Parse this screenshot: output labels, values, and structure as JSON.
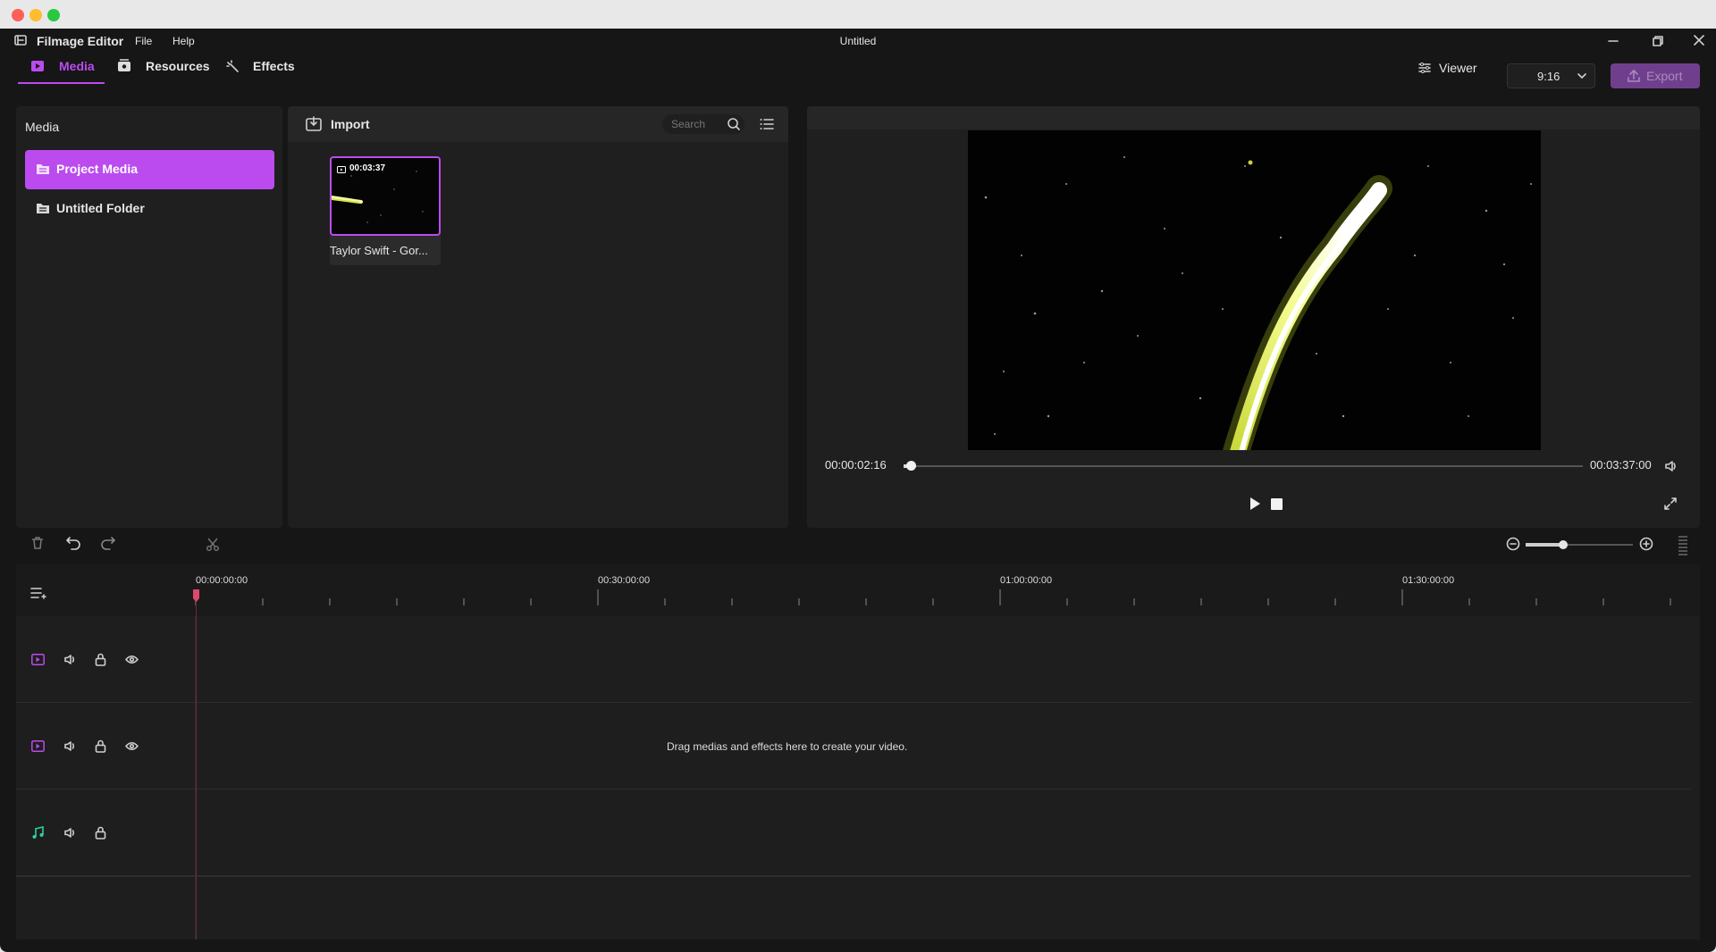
{
  "app": {
    "name": "Filmage Editor",
    "menu": [
      "File",
      "Help"
    ],
    "doc_title": "Untitled"
  },
  "top_tabs": {
    "media": "Media",
    "resources": "Resources",
    "effects": "Effects"
  },
  "toolbar": {
    "viewer_label": "Viewer",
    "aspect_ratio": "9:16",
    "export_label": "Export"
  },
  "media_panel": {
    "title": "Media",
    "folders": [
      "Project Media",
      "Untitled Folder"
    ],
    "active_folder": "Project Media"
  },
  "library": {
    "import_label": "Import",
    "search_placeholder": "Search",
    "clips": [
      {
        "duration": "00:03:37",
        "name": "Taylor Swift - Gor..."
      }
    ]
  },
  "viewer": {
    "current_time": "00:00:02:16",
    "total_time": "00:03:37:00",
    "progress": 0.01
  },
  "timeline": {
    "ruler_labels": [
      "00:00:00:00",
      "00:30:00:00",
      "01:00:00:00",
      "01:30:00:00"
    ],
    "zoom_level": 0.35,
    "empty_hint": "Drag medias and effects here to create your video."
  },
  "colors": {
    "accent": "#bb4bef",
    "export": "#6f3f8e",
    "audio_track": "#2ecfa0",
    "playhead": "#e0476c"
  }
}
